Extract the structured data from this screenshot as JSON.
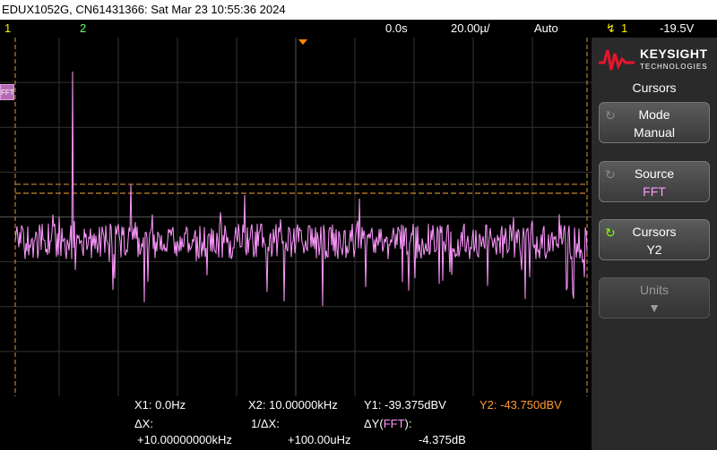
{
  "title_bar": "EDUX1052G, CN61431366: Sat Mar 23 10:55:36 2024",
  "status": {
    "ch1": "1",
    "ch2": "2",
    "time_offset": "0.0s",
    "timebase": "20.00µ/",
    "mode": "Auto",
    "trigger_source": "1",
    "trigger_level": "-19.5V"
  },
  "fft_tag": "FFT",
  "side_panel": {
    "logo_line1": "KEYSIGHT",
    "logo_line2": "TECHNOLOGIES",
    "title": "Cursors",
    "buttons": [
      {
        "label": "Mode",
        "value": "Manual"
      },
      {
        "label": "Source",
        "value": "FFT"
      },
      {
        "label": "Cursors",
        "value": "Y2"
      },
      {
        "label": "Units",
        "value": ""
      }
    ]
  },
  "readout": {
    "x1": "X1:  0.0Hz",
    "x2": "X2:  10.00000kHz",
    "y1": "Y1: -39.375dBV",
    "y2": "Y2: -43.750dBV",
    "dx_label": "ΔX:",
    "dx_value": "+10.00000000kHz",
    "inv_dx_label": "1/ΔX:",
    "inv_dx_value": "+100.00uHz",
    "dy_label": "ΔY(",
    "dy_src": "FFT",
    "dy_close": "):",
    "dy_value": "-4.375dB"
  },
  "colors": {
    "ch1": "#ffee00",
    "ch2": "#66ff66",
    "fft": "#ff99ff",
    "cursor": "#ff9933",
    "accent": "#ff6a00"
  }
}
